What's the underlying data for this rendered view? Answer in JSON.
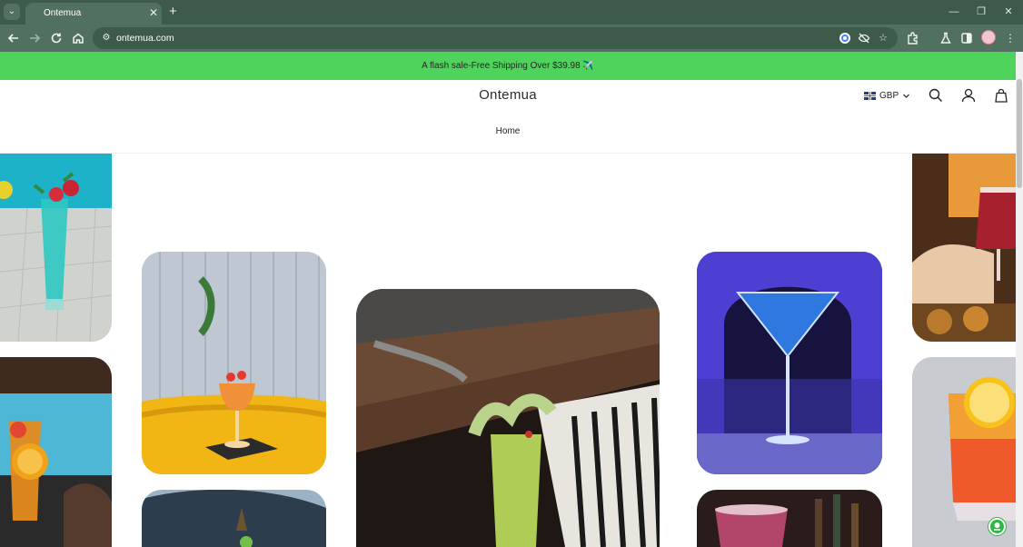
{
  "browser": {
    "tab_title": "Ontemua",
    "tab_close_icon": "close-icon",
    "new_tab_icon": "plus-icon",
    "tab_search_icon": "chevron-down-icon",
    "url": "ontemua.com",
    "window_controls": [
      "minimize-icon",
      "restore-icon",
      "close-icon"
    ],
    "nav_icons": [
      "back-icon",
      "forward-icon",
      "reload-icon",
      "home-icon"
    ],
    "omnibox_icons": [
      "google-lens-icon",
      "eye-off-icon",
      "star-icon"
    ],
    "toolbar_icons": [
      "extensions-icon",
      "labs-icon",
      "sidebar-icon",
      "profile-avatar",
      "menu-icon"
    ]
  },
  "site": {
    "announcement": "A flash sale-Free Shipping Over $39.98 ✈️",
    "logo": "Ontemua",
    "currency": "GBP",
    "nav": {
      "home": "Home"
    },
    "header_icons": [
      "search-icon",
      "account-icon",
      "cart-icon"
    ]
  },
  "colors": {
    "chrome_dark": "#3d5a4a",
    "chrome_toolbar": "#52705f",
    "announcement_bg": "#4fd45b",
    "chat_widget": "#2fb544"
  },
  "gallery": {
    "images": [
      "blue-cocktail-poolside",
      "orange-cocktail-beach",
      "orange-coupe-cocktail",
      "cocktail-glass-bottom",
      "green-cocktail-on-piano",
      "blue-martini",
      "red-smoothie",
      "red-cocktail-toast",
      "orange-citrus-cocktail"
    ]
  }
}
